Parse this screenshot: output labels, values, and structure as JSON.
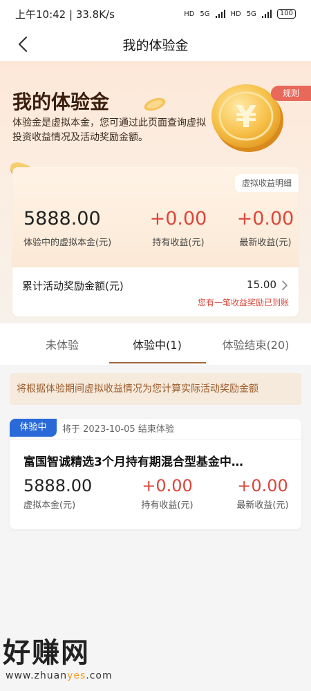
{
  "status_bar": {
    "time_speed": "上午10:42 | 33.8K/s",
    "network1": "5G",
    "network2": "5G",
    "hd": "HD",
    "battery": "100"
  },
  "nav": {
    "title": "我的体验金"
  },
  "hero": {
    "title": "我的体验金",
    "description": "体验金是虚拟本金，您可通过此页面查询虚拟投资收益情况及活动奖励金额。",
    "rules_label": "规则",
    "coin_glyph": "¥"
  },
  "summary": {
    "detail_link": "虚拟收益明细",
    "principal_value": "5888.00",
    "principal_label": "体验中的虚拟本金(元)",
    "holding_value": "+0.00",
    "holding_label": "持有收益(元)",
    "latest_value": "+0.00",
    "latest_label": "最新收益(元)",
    "cumulative_label": "累计活动奖励金额(元)",
    "cumulative_value": "15.00",
    "cumulative_notice": "您有一笔收益奖励已到账"
  },
  "tabs": [
    {
      "label": "未体验"
    },
    {
      "label": "体验中(1)"
    },
    {
      "label": "体验结束(20)"
    }
  ],
  "notice": "将根据体验期间虚拟收益情况为您计算实际活动奖励金额",
  "fund_card": {
    "badge": "体验中",
    "end_note": "将于 2023-10-05 结束体验",
    "fund_name": "富国智诚精选3个月持有期混合型基金中…",
    "principal_value": "5888.00",
    "principal_label": "虚拟本金(元)",
    "holding_value": "+0.00",
    "holding_label": "持有收益(元)",
    "latest_value": "+0.00",
    "latest_label": "最新收益(元)"
  },
  "watermark": {
    "main": "好赚网",
    "url_prefix": "www.zhuan",
    "url_highlight": "yes",
    "url_suffix": ".com"
  },
  "colors": {
    "accent_red": "#d9473c",
    "badge_blue": "#2a6ad8",
    "tab_underline": "#a0673d"
  }
}
